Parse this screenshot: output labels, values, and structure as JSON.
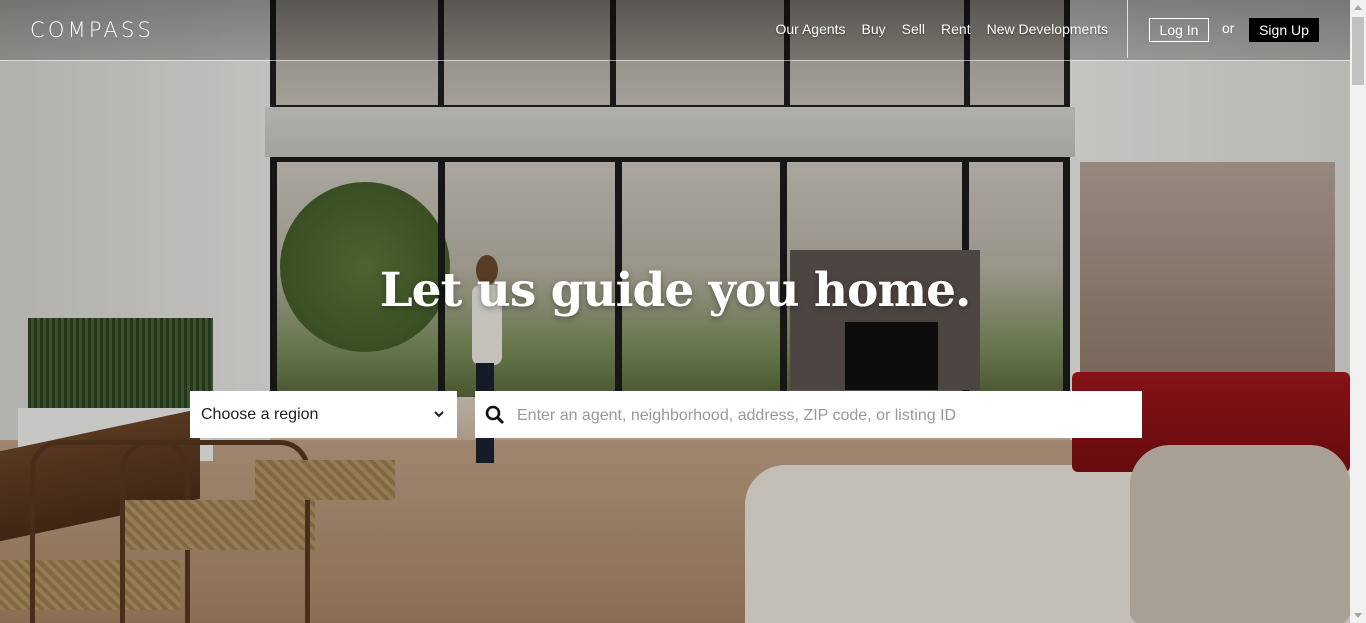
{
  "brand": {
    "logo_text": "COMPASS"
  },
  "nav": {
    "items": [
      {
        "label": "Our Agents"
      },
      {
        "label": "Buy"
      },
      {
        "label": "Sell"
      },
      {
        "label": "Rent"
      },
      {
        "label": "New Developments"
      }
    ],
    "login_label": "Log In",
    "or_label": "or",
    "signup_label": "Sign Up"
  },
  "hero": {
    "headline": "Let us guide you home.",
    "region_select": {
      "selected": "Choose a region",
      "icon": "chevron-down-icon"
    },
    "search": {
      "placeholder": "Enter an agent, neighborhood, address, ZIP code, or listing ID",
      "value": "",
      "icon": "search-icon"
    }
  },
  "colors": {
    "header_text": "#ffffff",
    "signup_bg": "#000000",
    "sofa": "#a3161b"
  }
}
